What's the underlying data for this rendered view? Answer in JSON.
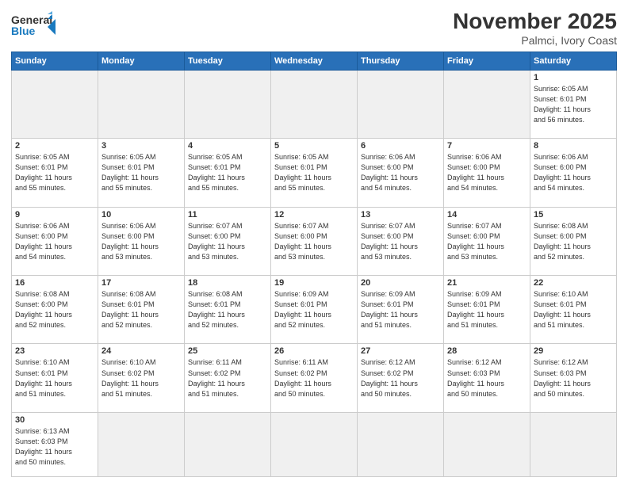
{
  "header": {
    "logo_general": "General",
    "logo_blue": "Blue",
    "month_title": "November 2025",
    "subtitle": "Palmci, Ivory Coast"
  },
  "weekdays": [
    "Sunday",
    "Monday",
    "Tuesday",
    "Wednesday",
    "Thursday",
    "Friday",
    "Saturday"
  ],
  "weeks": [
    [
      {
        "day": "",
        "info": ""
      },
      {
        "day": "",
        "info": ""
      },
      {
        "day": "",
        "info": ""
      },
      {
        "day": "",
        "info": ""
      },
      {
        "day": "",
        "info": ""
      },
      {
        "day": "",
        "info": ""
      },
      {
        "day": "1",
        "info": "Sunrise: 6:05 AM\nSunset: 6:01 PM\nDaylight: 11 hours\nand 56 minutes."
      }
    ],
    [
      {
        "day": "2",
        "info": "Sunrise: 6:05 AM\nSunset: 6:01 PM\nDaylight: 11 hours\nand 55 minutes."
      },
      {
        "day": "3",
        "info": "Sunrise: 6:05 AM\nSunset: 6:01 PM\nDaylight: 11 hours\nand 55 minutes."
      },
      {
        "day": "4",
        "info": "Sunrise: 6:05 AM\nSunset: 6:01 PM\nDaylight: 11 hours\nand 55 minutes."
      },
      {
        "day": "5",
        "info": "Sunrise: 6:05 AM\nSunset: 6:01 PM\nDaylight: 11 hours\nand 55 minutes."
      },
      {
        "day": "6",
        "info": "Sunrise: 6:06 AM\nSunset: 6:00 PM\nDaylight: 11 hours\nand 54 minutes."
      },
      {
        "day": "7",
        "info": "Sunrise: 6:06 AM\nSunset: 6:00 PM\nDaylight: 11 hours\nand 54 minutes."
      },
      {
        "day": "8",
        "info": "Sunrise: 6:06 AM\nSunset: 6:00 PM\nDaylight: 11 hours\nand 54 minutes."
      }
    ],
    [
      {
        "day": "9",
        "info": "Sunrise: 6:06 AM\nSunset: 6:00 PM\nDaylight: 11 hours\nand 54 minutes."
      },
      {
        "day": "10",
        "info": "Sunrise: 6:06 AM\nSunset: 6:00 PM\nDaylight: 11 hours\nand 53 minutes."
      },
      {
        "day": "11",
        "info": "Sunrise: 6:07 AM\nSunset: 6:00 PM\nDaylight: 11 hours\nand 53 minutes."
      },
      {
        "day": "12",
        "info": "Sunrise: 6:07 AM\nSunset: 6:00 PM\nDaylight: 11 hours\nand 53 minutes."
      },
      {
        "day": "13",
        "info": "Sunrise: 6:07 AM\nSunset: 6:00 PM\nDaylight: 11 hours\nand 53 minutes."
      },
      {
        "day": "14",
        "info": "Sunrise: 6:07 AM\nSunset: 6:00 PM\nDaylight: 11 hours\nand 53 minutes."
      },
      {
        "day": "15",
        "info": "Sunrise: 6:08 AM\nSunset: 6:00 PM\nDaylight: 11 hours\nand 52 minutes."
      }
    ],
    [
      {
        "day": "16",
        "info": "Sunrise: 6:08 AM\nSunset: 6:00 PM\nDaylight: 11 hours\nand 52 minutes."
      },
      {
        "day": "17",
        "info": "Sunrise: 6:08 AM\nSunset: 6:01 PM\nDaylight: 11 hours\nand 52 minutes."
      },
      {
        "day": "18",
        "info": "Sunrise: 6:08 AM\nSunset: 6:01 PM\nDaylight: 11 hours\nand 52 minutes."
      },
      {
        "day": "19",
        "info": "Sunrise: 6:09 AM\nSunset: 6:01 PM\nDaylight: 11 hours\nand 52 minutes."
      },
      {
        "day": "20",
        "info": "Sunrise: 6:09 AM\nSunset: 6:01 PM\nDaylight: 11 hours\nand 51 minutes."
      },
      {
        "day": "21",
        "info": "Sunrise: 6:09 AM\nSunset: 6:01 PM\nDaylight: 11 hours\nand 51 minutes."
      },
      {
        "day": "22",
        "info": "Sunrise: 6:10 AM\nSunset: 6:01 PM\nDaylight: 11 hours\nand 51 minutes."
      }
    ],
    [
      {
        "day": "23",
        "info": "Sunrise: 6:10 AM\nSunset: 6:01 PM\nDaylight: 11 hours\nand 51 minutes."
      },
      {
        "day": "24",
        "info": "Sunrise: 6:10 AM\nSunset: 6:02 PM\nDaylight: 11 hours\nand 51 minutes."
      },
      {
        "day": "25",
        "info": "Sunrise: 6:11 AM\nSunset: 6:02 PM\nDaylight: 11 hours\nand 51 minutes."
      },
      {
        "day": "26",
        "info": "Sunrise: 6:11 AM\nSunset: 6:02 PM\nDaylight: 11 hours\nand 50 minutes."
      },
      {
        "day": "27",
        "info": "Sunrise: 6:12 AM\nSunset: 6:02 PM\nDaylight: 11 hours\nand 50 minutes."
      },
      {
        "day": "28",
        "info": "Sunrise: 6:12 AM\nSunset: 6:03 PM\nDaylight: 11 hours\nand 50 minutes."
      },
      {
        "day": "29",
        "info": "Sunrise: 6:12 AM\nSunset: 6:03 PM\nDaylight: 11 hours\nand 50 minutes."
      }
    ],
    [
      {
        "day": "30",
        "info": "Sunrise: 6:13 AM\nSunset: 6:03 PM\nDaylight: 11 hours\nand 50 minutes."
      },
      {
        "day": "",
        "info": ""
      },
      {
        "day": "",
        "info": ""
      },
      {
        "day": "",
        "info": ""
      },
      {
        "day": "",
        "info": ""
      },
      {
        "day": "",
        "info": ""
      },
      {
        "day": "",
        "info": ""
      }
    ]
  ]
}
